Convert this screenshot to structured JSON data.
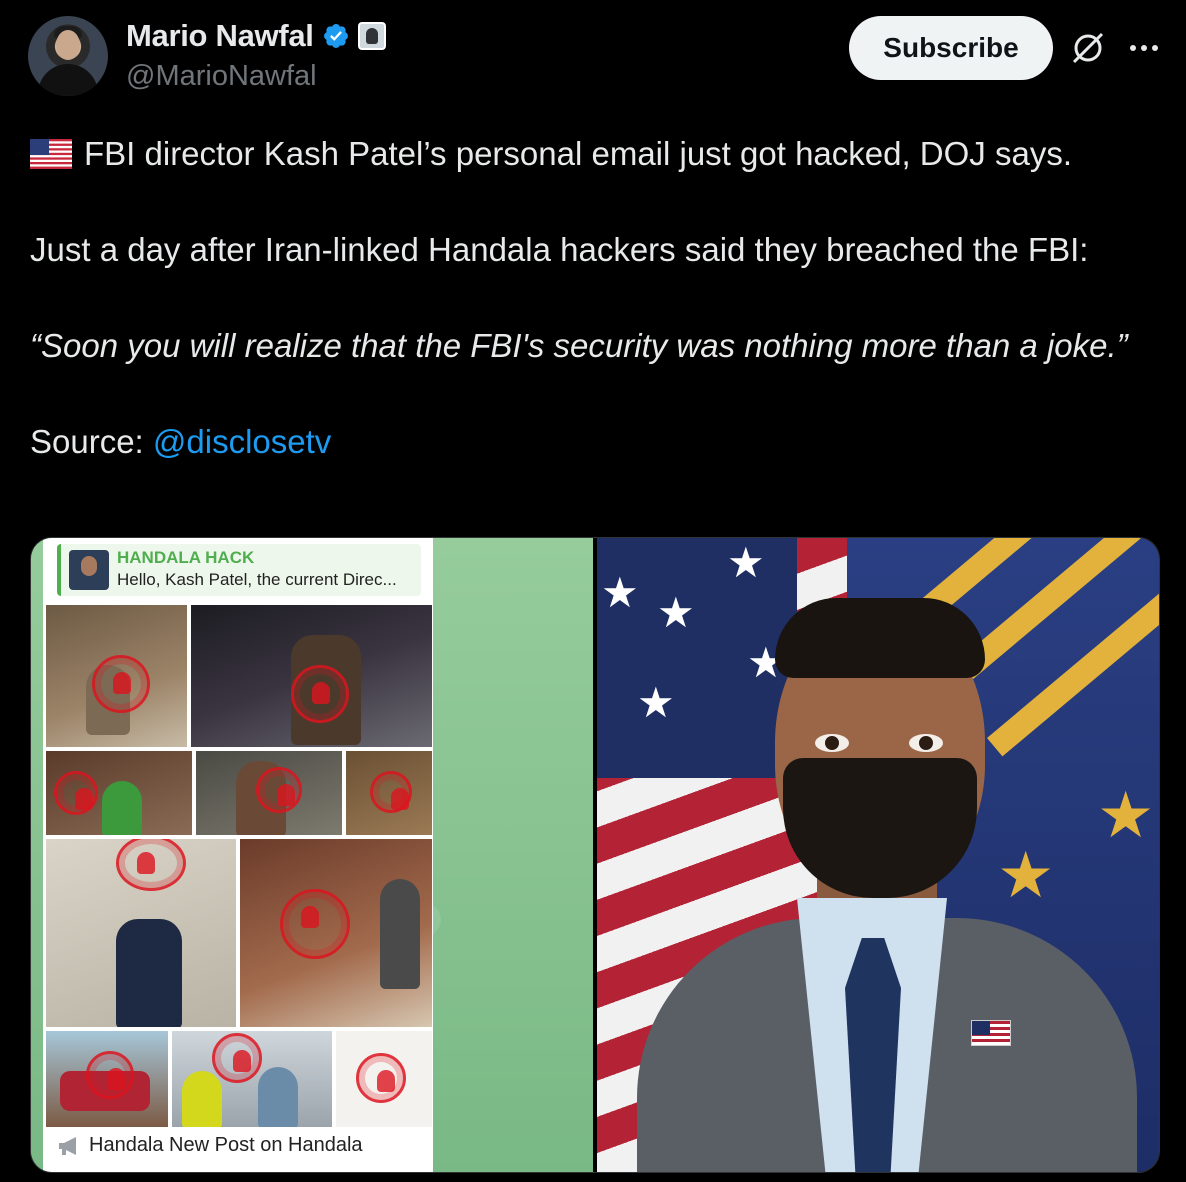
{
  "author": {
    "display_name": "Mario Nawfal",
    "handle": "@MarioNawfal",
    "avatar_icon": "avatar",
    "verified_icon": "verified-badge-icon",
    "affiliate_icon": "affiliate-badge-icon"
  },
  "actions": {
    "subscribe_label": "Subscribe",
    "grok_icon": "grok-icon",
    "more_icon": "more-icon"
  },
  "tweet": {
    "line1_flag_icon": "us-flag-icon",
    "line1": "FBI director Kash Patel’s personal email just got hacked, DOJ says.",
    "line2": "Just a day after Iran-linked Handala hackers said they breached the FBI:",
    "quote": "“Soon you will realize that the FBI's security was nothing more than a joke.”",
    "source_label": "Source: ",
    "source_mention": "@disclosetv"
  },
  "media": {
    "left": {
      "reply_title": "HANDALA HACK",
      "reply_text": "Hello, Kash Patel, the current Direc...",
      "footer_text": "Handala New Post on Handala"
    }
  },
  "colors": {
    "background": "#000000",
    "text": "#e7e9ea",
    "secondary": "#71767b",
    "link": "#1d9bf0",
    "verified": "#1d9bf0"
  }
}
